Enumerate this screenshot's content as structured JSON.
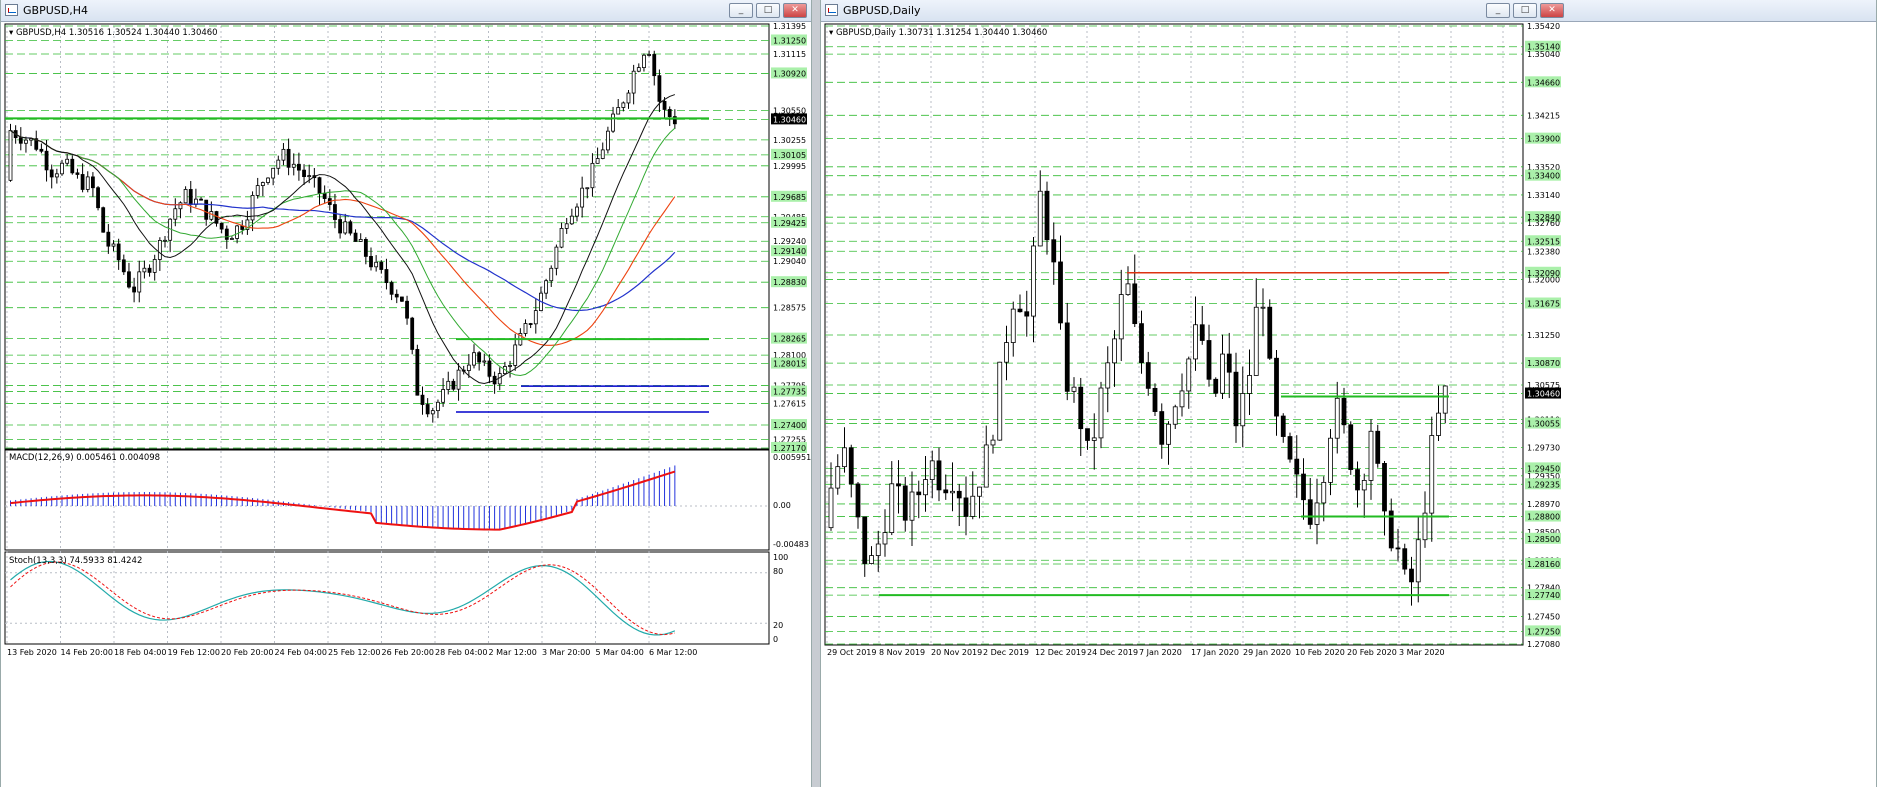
{
  "left_window": {
    "title": "GBPUSD,H4",
    "info": "GBPUSD,H4  1.30516 1.30524 1.30440 1.30460",
    "main_price_labels": [
      "1.31395",
      "1.31250",
      "1.31115",
      "1.30920",
      "1.30550",
      "1.30460",
      "1.30255",
      "1.30105",
      "1.29995",
      "1.29685",
      "1.29485",
      "1.29425",
      "1.29240",
      "1.29140",
      "1.29040",
      "1.28830",
      "1.28575",
      "1.28265",
      "1.28100",
      "1.28015",
      "1.27795",
      "1.27735",
      "1.27615",
      "1.27400",
      "1.27255",
      "1.27170"
    ],
    "macd": {
      "label": "MACD(12,26,9) 0.005461 0.004098",
      "scale": [
        "0.005951",
        "0.00",
        "-0.00483"
      ]
    },
    "stoch": {
      "label": "Stoch(13,3,3) 74.5933 81.4242",
      "scale": [
        "100",
        "80",
        "20",
        "0"
      ]
    },
    "time_labels": [
      "13 Feb 2020",
      "14 Feb 20:00",
      "18 Feb 04:00",
      "19 Feb 12:00",
      "20 Feb 20:00",
      "24 Feb 04:00",
      "25 Feb 12:00",
      "26 Feb 20:00",
      "28 Feb 04:00",
      "2 Mar 12:00",
      "3 Mar 20:00",
      "5 Mar 04:00",
      "6 Mar 12:00"
    ]
  },
  "right_window": {
    "title": "GBPUSD,Daily",
    "info": "GBPUSD,Daily  1.30731 1.31254 1.30440 1.30460",
    "price_labels": [
      "1.35420",
      "1.35140",
      "1.35040",
      "1.34660",
      "1.34215",
      "1.33900",
      "1.33520",
      "1.33400",
      "1.33140",
      "1.32840",
      "1.32760",
      "1.32515",
      "1.32380",
      "1.32090",
      "1.32000",
      "1.31675",
      "1.31250",
      "1.30870",
      "1.30575",
      "1.30460",
      "1.30110",
      "1.30055",
      "1.29730",
      "1.29450",
      "1.29350",
      "1.29235",
      "1.28970",
      "1.28800",
      "1.28590",
      "1.28500",
      "1.28210",
      "1.28160",
      "1.27840",
      "1.27740",
      "1.27450",
      "1.27250",
      "1.27080"
    ],
    "time_labels": [
      "29 Oct 2019",
      "8 Nov 2019",
      "20 Nov 2019",
      "2 Dec 2019",
      "12 Dec 2019",
      "24 Dec 2019",
      "7 Jan 2020",
      "17 Jan 2020",
      "29 Jan 2020",
      "10 Feb 2020",
      "20 Feb 2020",
      "3 Mar 2020"
    ]
  },
  "window_buttons": {
    "minimize": "_",
    "maximize": "□",
    "close": "✕"
  },
  "colors": {
    "bull": "#000000",
    "bear": "#000000",
    "grid": "#b8bdc6",
    "level": "#33bb33",
    "resistance": "#dd3311",
    "support_blue": "#0000cc",
    "ma_blue": "#2233cc",
    "ma_red": "#ee4411",
    "ma_green": "#33aa33",
    "ma_black": "#111111",
    "macd_hist": "#2233dd",
    "macd_signal": "#ee1111",
    "stoch_main": "#22aaaa",
    "stoch_signal": "#ee1111",
    "label_bg": "#aaf0aa"
  }
}
